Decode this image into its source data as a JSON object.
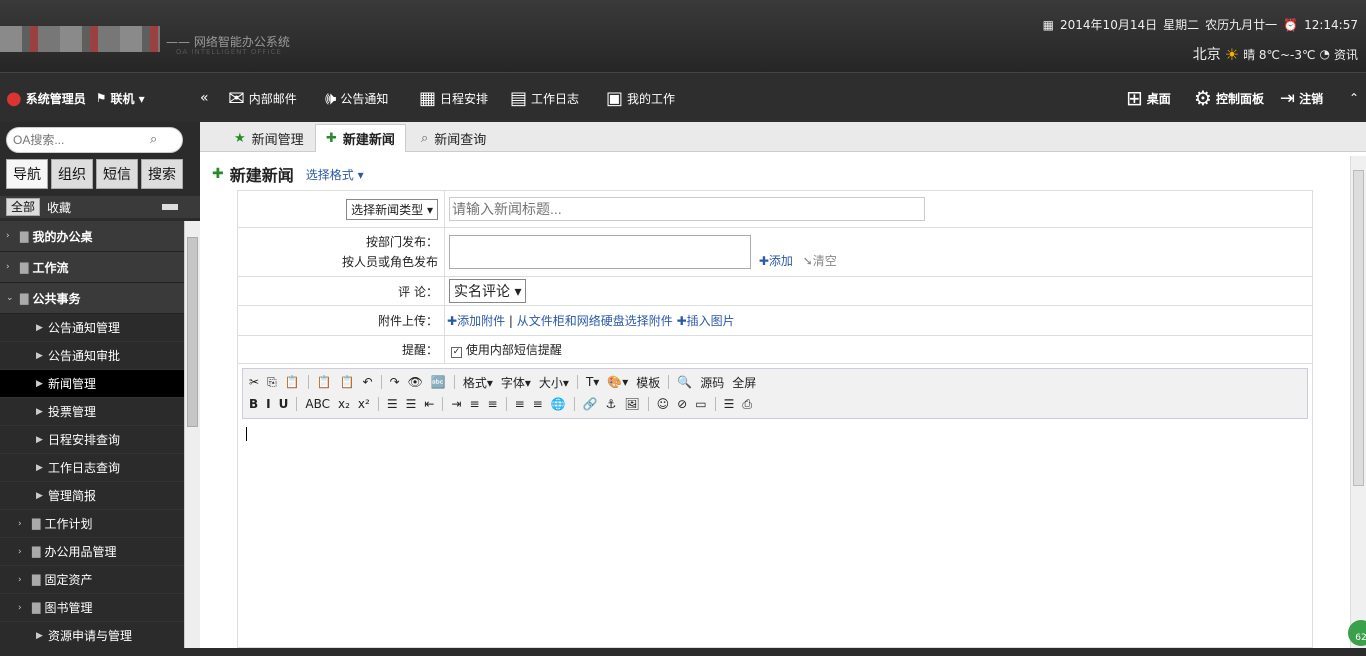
{
  "header": {
    "slogan": "—— 网络智能办公系统",
    "slogan_en": "OA INTELLIGENT OFFICE",
    "date": "2014年10月14日",
    "weekday": "星期二",
    "lunar": "农历九月廿一",
    "time": "12:14:57",
    "city": "北京",
    "weather": "晴 8℃~-3℃",
    "news": "资讯"
  },
  "toolbar": {
    "user": "系统管理员",
    "status": "联机 ▾",
    "nav": [
      "内部邮件",
      "公告通知",
      "日程安排",
      "工作日志",
      "我的工作"
    ],
    "right": [
      "桌面",
      "控制面板",
      "注销"
    ]
  },
  "sidebar": {
    "search_placeholder": "OA搜索...",
    "tabs": [
      "导航",
      "组织",
      "短信",
      "搜索"
    ],
    "scope_all": "全部",
    "scope_fav": "收藏",
    "items": [
      {
        "label": "我的办公桌",
        "level": 0
      },
      {
        "label": "工作流",
        "level": 0
      },
      {
        "label": "公共事务",
        "level": 0,
        "open": true
      },
      {
        "label": "公告通知管理",
        "level": 1
      },
      {
        "label": "公告通知审批",
        "level": 1
      },
      {
        "label": "新闻管理",
        "level": 1,
        "active": true
      },
      {
        "label": "投票管理",
        "level": 1
      },
      {
        "label": "日程安排查询",
        "level": 1
      },
      {
        "label": "工作日志查询",
        "level": 1
      },
      {
        "label": "管理简报",
        "level": 1
      },
      {
        "label": "工作计划",
        "level": 1,
        "folder": true
      },
      {
        "label": "办公用品管理",
        "level": 1,
        "folder": true
      },
      {
        "label": "固定资产",
        "level": 1,
        "folder": true
      },
      {
        "label": "图书管理",
        "level": 1,
        "folder": true
      },
      {
        "label": "资源申请与管理",
        "level": 1
      }
    ]
  },
  "tabs": [
    "新闻管理",
    "新建新闻",
    "新闻查询"
  ],
  "page": {
    "title": "新建新闻",
    "format": "选择格式 ▾"
  },
  "form": {
    "type_select": "选择新闻类型",
    "title_placeholder": "请输入新闻标题...",
    "publish_label1": "按部门发布：",
    "publish_label2": "按人员或角色发布",
    "add": "添加",
    "clear": "清空",
    "comment_label": "评  论：",
    "comment_value": "实名评论",
    "attach_label": "附件上传：",
    "attach_add": "添加附件",
    "attach_from": "从文件柜和网络硬盘选择附件",
    "insert_image": "插入图片",
    "remind_label": "提醒：",
    "remind_text": "使用内部短信提醒"
  },
  "editor": {
    "row1": [
      "✂",
      "⎘",
      "📋",
      "📋",
      "📋",
      "↶",
      "↷",
      "👁",
      "🔤",
      "格式▾",
      "字体▾",
      "大小▾",
      "T▾",
      "🎨▾",
      "模板",
      "🔍",
      "源码",
      "全屏"
    ],
    "row2": [
      "B",
      "I",
      "U",
      "ABC",
      "x₂",
      "x²",
      "☰",
      "☰",
      "⇤",
      "⇥",
      "≡",
      "≡",
      "≡",
      "≡",
      "🌐",
      "🔗",
      "⚓",
      "🖼",
      "☺",
      "⊘",
      "▭",
      "☰",
      "⎙"
    ]
  },
  "badge": "62"
}
